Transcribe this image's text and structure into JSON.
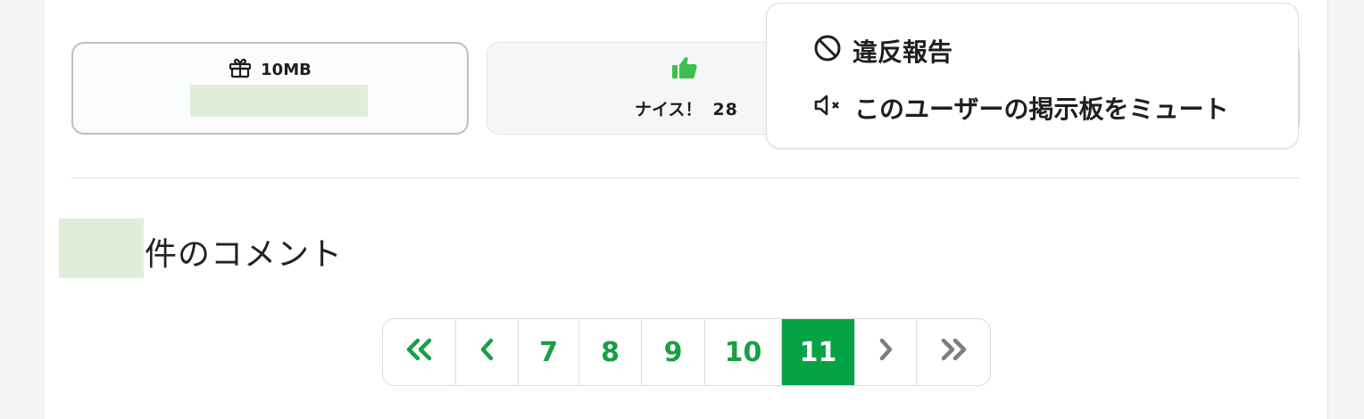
{
  "gift": {
    "label": "10MB",
    "icon": "gift-icon"
  },
  "nice": {
    "label": "ナイス！",
    "count": "28",
    "icon": "thumbs-up-icon",
    "color": "#3dbe4e"
  },
  "context_menu": {
    "items": [
      {
        "label": "違反報告",
        "icon": "ban-icon"
      },
      {
        "label": "このユーザーの掲示板をミュート",
        "icon": "mute-icon"
      }
    ]
  },
  "comments": {
    "label": "件のコメント"
  },
  "pagination": {
    "first_icon": "double-chevron-left-icon",
    "prev_icon": "chevron-left-icon",
    "pages": [
      "7",
      "8",
      "9",
      "10",
      "11"
    ],
    "current": "11",
    "next_icon": "chevron-right-icon",
    "last_icon": "double-chevron-right-icon"
  },
  "colors": {
    "accent": "#06a346",
    "placeholder": "#e0eed8",
    "link": "#17a044"
  }
}
